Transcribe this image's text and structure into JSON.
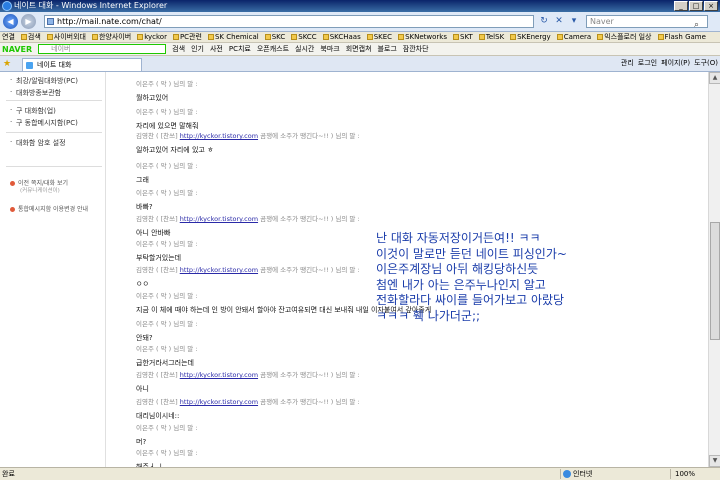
{
  "window": {
    "title": "네이트 대화 - Windows Internet Explorer"
  },
  "address": {
    "url": "http://mail.nate.com/chat/",
    "search_placeholder": "Naver"
  },
  "favorites": [
    "연결",
    "검색",
    "사이버외대",
    "한양사이버",
    "kyckor",
    "PC관련",
    "SK Chemical",
    "SKC",
    "SKCC",
    "SKCHaas",
    "SKEC",
    "SKNetworks",
    "SKT",
    "TelSK",
    "SKEnergy",
    "Camera",
    "익스플로러 일상",
    "Flash Game"
  ],
  "naver_bar": {
    "logo": "NAVER",
    "search_placeholder": "네이버",
    "items": [
      "검색",
      "인기",
      "사전",
      "PC치료",
      "오픈캐스트",
      "실시간",
      "북마크",
      "회면캡쳐",
      "블로그",
      "잠깐차단"
    ]
  },
  "tab": {
    "label": "네이트 대화",
    "tools": [
      "관리",
      "로그인",
      "페이지(P)",
      "도구(O)"
    ]
  },
  "sidebar": {
    "items": [
      "최강/알림대화방(PC)",
      "대화방종보관함",
      "구 대화함(업)",
      "구 동합메시지함(PC)",
      "대화함 암호 설정"
    ],
    "links": [
      {
        "label": "이전 쪽지/대화 보기",
        "sub": "(커뮤니케이션이)"
      },
      {
        "label": "통합메시지함 이용변경 안내",
        "sub": ""
      }
    ]
  },
  "chat": {
    "messages": [
      {
        "sender": "이은주 ( 악 ) 님의 말 :",
        "link": "",
        "suffix": "",
        "body": "월하고있어"
      },
      {
        "sender": "이은주 ( 악 ) 님의 말 :",
        "link": "",
        "suffix": "",
        "body": "자리에 있으면 말해줘"
      },
      {
        "sender": "김영찬 ( [찬쓰] ",
        "link": "http://kyckor.tistory.com",
        "suffix": " 곰쟁에 소주가 땡긴다~!! ) 님의 말 :",
        "body": "일하고있어 자리에 있고 ㅎ"
      },
      {
        "sender": "이은주 ( 악 ) 님의 말 :",
        "link": "",
        "suffix": "",
        "body": "그래"
      },
      {
        "sender": "이은주 ( 악 ) 님의 말 :",
        "link": "",
        "suffix": "",
        "body": "바빠?"
      },
      {
        "sender": "김영찬 ( [찬쓰] ",
        "link": "http://kyckor.tistory.com",
        "suffix": " 곰쟁에 소주가 땡긴다~!! ) 님의 말 :",
        "body": "아니 안바빠"
      },
      {
        "sender": "이은주 ( 악 ) 님의 말 :",
        "link": "",
        "suffix": "",
        "body": "부탁할거있는데"
      },
      {
        "sender": "김영찬 ( [찬쓰] ",
        "link": "http://kyckor.tistory.com",
        "suffix": " 곰쟁에 소주가 땡긴다~!! ) 님의 말 :",
        "body": "ㅇㅇ"
      },
      {
        "sender": "이은주 ( 악 ) 님의 말 :",
        "link": "",
        "suffix": "",
        "body": "지금 이 체에 때야 하는데 인 방이 안돼서 할아야 잔고여유되면 대신 보내줘 내일 이자붙여서 갚아줄게"
      },
      {
        "sender": "이은주 ( 악 ) 님의 말 :",
        "link": "",
        "suffix": "",
        "body": "안돼?"
      },
      {
        "sender": "이은주 ( 악 ) 님의 말 :",
        "link": "",
        "suffix": "",
        "body": "급한거라서그러는데"
      },
      {
        "sender": "김영찬 ( [찬쓰] ",
        "link": "http://kyckor.tistory.com",
        "suffix": " 곰쟁에 소주가 땡긴다~!! ) 님의 말 :",
        "body": "아니"
      },
      {
        "sender": "김영찬 ( [찬쓰] ",
        "link": "http://kyckor.tistory.com",
        "suffix": " 곰쟁에 소주가 땡긴다~!! ) 님의 말 :",
        "body": "대리님이시네::"
      },
      {
        "sender": "이은주 ( 악 ) 님의 말 :",
        "link": "",
        "suffix": "",
        "body": "머?"
      },
      {
        "sender": "이은주 ( 악 ) 님의 말 :",
        "link": "",
        "suffix": "",
        "body": "해주ㅓ ㅣ"
      }
    ]
  },
  "overlay_text": [
    "난 대화 자동저장이거든여!! ㅋㅋ",
    "이것이 말로만 듣던 네이트 피싱인가~",
    "이은주계장님 아뒤 해킹당하신듯",
    "첨엔 내가 아는 은주누나인지 알고",
    "전화할라다 싸이를 들어가보고 아랐당",
    "ㅋㅋㅋ 훽 나가더군;;"
  ],
  "status": {
    "left": "완료",
    "zone": "인터넷",
    "zoom": "100%"
  }
}
